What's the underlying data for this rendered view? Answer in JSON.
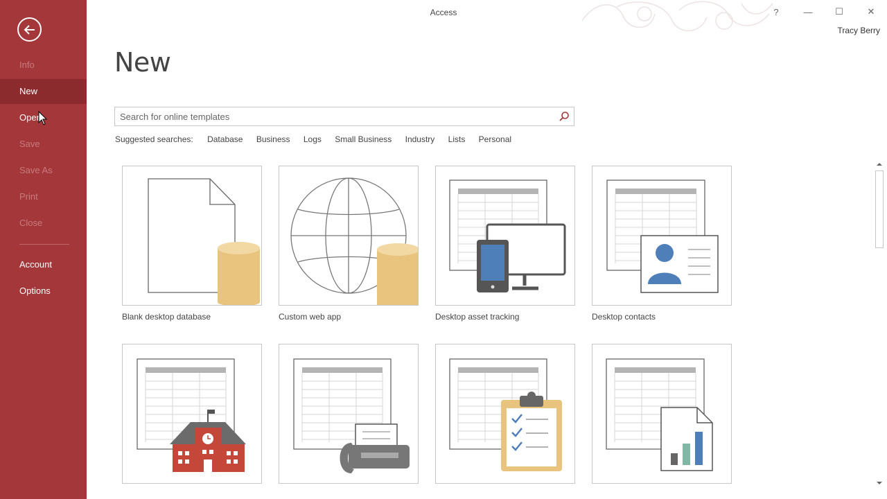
{
  "window": {
    "title": "Access",
    "user": "Tracy Berry",
    "help_glyph": "?",
    "minimize_glyph": "—",
    "restore_glyph": "☐",
    "close_glyph": "✕"
  },
  "sidebar": {
    "items": [
      {
        "label": "Info",
        "state": "disabled"
      },
      {
        "label": "New",
        "state": "active"
      },
      {
        "label": "Open",
        "state": "enabled"
      },
      {
        "label": "Save",
        "state": "disabled"
      },
      {
        "label": "Save As",
        "state": "disabled"
      },
      {
        "label": "Print",
        "state": "disabled"
      },
      {
        "label": "Close",
        "state": "disabled"
      },
      {
        "label": "Account",
        "state": "enabled"
      },
      {
        "label": "Options",
        "state": "enabled"
      }
    ]
  },
  "main": {
    "title": "New",
    "search": {
      "placeholder": "Search for online templates"
    },
    "suggested_label": "Suggested searches:",
    "suggested": [
      "Database",
      "Business",
      "Logs",
      "Small Business",
      "Industry",
      "Lists",
      "Personal"
    ],
    "templates": [
      {
        "label": "Blank desktop database",
        "icon": "blank-database-icon"
      },
      {
        "label": "Custom web app",
        "icon": "globe-database-icon"
      },
      {
        "label": "Desktop asset tracking",
        "icon": "monitor-tablet-icon"
      },
      {
        "label": "Desktop contacts",
        "icon": "contact-card-icon"
      },
      {
        "label": "",
        "icon": "school-icon"
      },
      {
        "label": "",
        "icon": "phone-fax-icon"
      },
      {
        "label": "",
        "icon": "clipboard-checklist-icon"
      },
      {
        "label": "",
        "icon": "bar-chart-document-icon"
      }
    ]
  },
  "colors": {
    "accent": "#a4373a",
    "accent_dark": "#8c2b2e",
    "database_yellow": "#e8c47e",
    "icon_blue": "#4e7fb8",
    "school_red": "#c4473a",
    "chart_teal": "#7fb8a4"
  }
}
